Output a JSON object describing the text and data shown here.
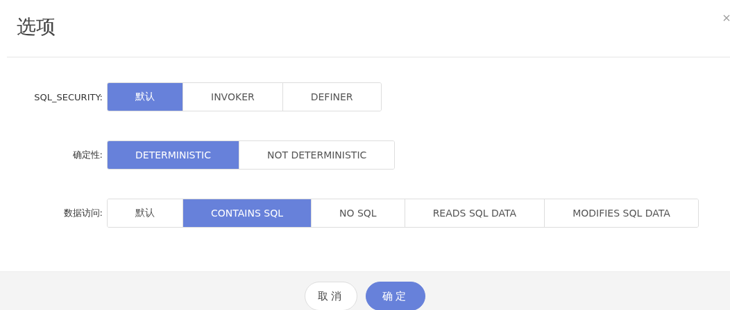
{
  "dialog": {
    "title": "选项"
  },
  "options": [
    {
      "label": "SQL_SECURITY:",
      "choices": [
        {
          "label": "默认",
          "selected": true
        },
        {
          "label": "INVOKER",
          "selected": false
        },
        {
          "label": "DEFINER",
          "selected": false
        }
      ]
    },
    {
      "label": "确定性:",
      "choices": [
        {
          "label": "DETERMINISTIC",
          "selected": true
        },
        {
          "label": "NOT DETERMINISTIC",
          "selected": false
        }
      ]
    },
    {
      "label": "数据访问:",
      "choices": [
        {
          "label": "默认",
          "selected": false
        },
        {
          "label": "CONTAINS SQL",
          "selected": true
        },
        {
          "label": "NO SQL",
          "selected": false
        },
        {
          "label": "READS SQL DATA",
          "selected": false
        },
        {
          "label": "MODIFIES SQL DATA",
          "selected": false
        }
      ]
    }
  ],
  "buttons": [
    {
      "label": "取消",
      "kind": "secondary"
    },
    {
      "label": "确定",
      "kind": "primary"
    }
  ]
}
